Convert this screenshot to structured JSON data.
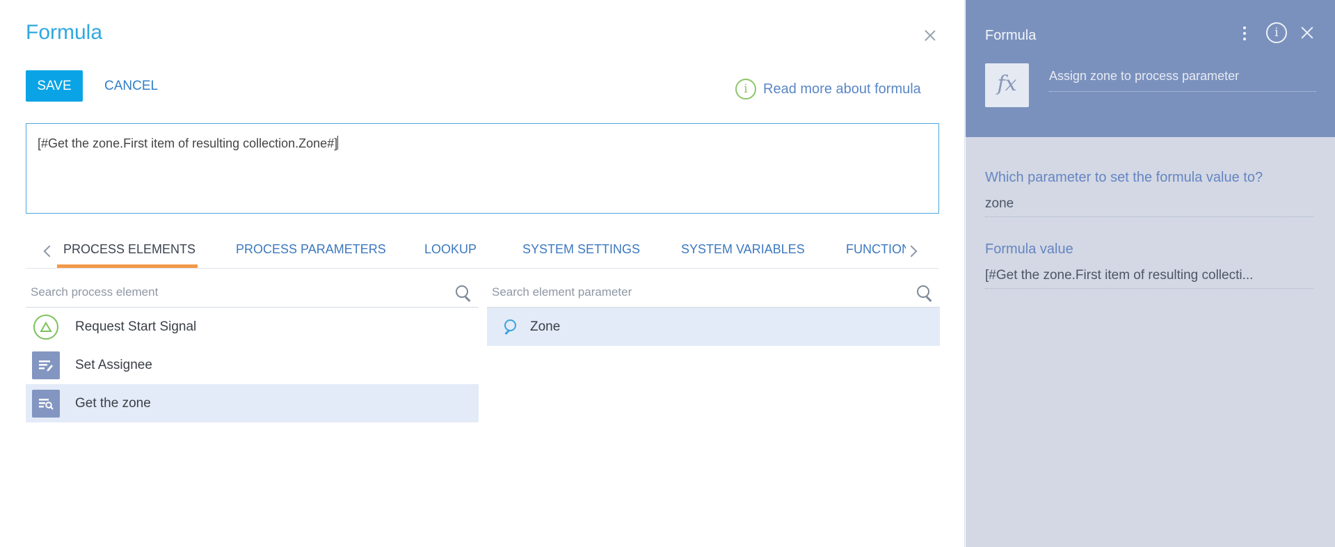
{
  "dialog": {
    "title": "Formula",
    "save_label": "SAVE",
    "cancel_label": "CANCEL",
    "read_more": "Read more about formula",
    "formula_text": "[#Get the zone.First item of resulting collection.Zone#]"
  },
  "tabs": [
    {
      "label": "PROCESS ELEMENTS",
      "active": true
    },
    {
      "label": "PROCESS PARAMETERS"
    },
    {
      "label": "LOOKUP"
    },
    {
      "label": "SYSTEM SETTINGS"
    },
    {
      "label": "SYSTEM VARIABLES"
    },
    {
      "label": "FUNCTIONS"
    }
  ],
  "elements_search": {
    "placeholder": "Search process element"
  },
  "elements": [
    {
      "label": "Request Start Signal",
      "icon": "start-signal-icon"
    },
    {
      "label": "Set Assignee",
      "icon": "edit-task-icon"
    },
    {
      "label": "Get the zone",
      "icon": "read-data-icon",
      "selected": true
    }
  ],
  "params_search": {
    "placeholder": "Search element parameter"
  },
  "params": [
    {
      "label": "Zone",
      "selected": true
    }
  ],
  "panel": {
    "title": "Formula",
    "element_name": "Assign zone to process parameter",
    "param_question": "Which parameter to set the formula value to?",
    "param_value": "zone",
    "formula_label": "Formula value",
    "formula_value": "[#Get the zone.First item of resulting collecti..."
  },
  "colors": {
    "accent_blue": "#0aa4e6",
    "tab_underline": "#f2994a",
    "panel_header": "#7b91bd",
    "panel_body": "#d3d8e4",
    "selected_row": "#e3ebf8"
  }
}
